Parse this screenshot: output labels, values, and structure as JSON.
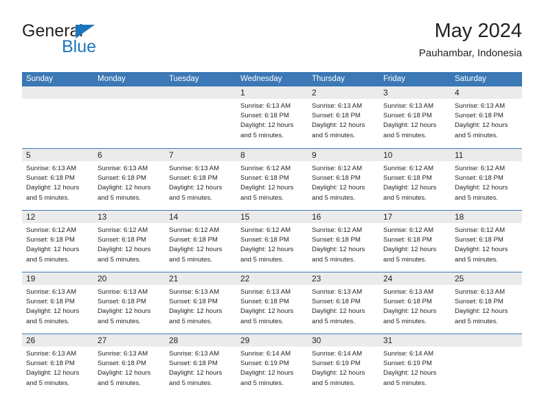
{
  "logo": {
    "word_top": "General",
    "word_bottom": "Blue",
    "triangle_icon": "triangle-icon",
    "color_dark": "#231f20",
    "color_blue": "#1c75bc"
  },
  "header": {
    "title": "May 2024",
    "subtitle": "Pauhambar, Indonesia"
  },
  "theme": {
    "header_blue": "#3b78b5",
    "band_gray": "#ebebeb",
    "text": "#231f20"
  },
  "weekdays": [
    "Sunday",
    "Monday",
    "Tuesday",
    "Wednesday",
    "Thursday",
    "Friday",
    "Saturday"
  ],
  "weeks": [
    [
      {
        "day": "",
        "sunrise": "",
        "sunset": "",
        "daylight_line1": "",
        "daylight_line2": "",
        "empty": true
      },
      {
        "day": "",
        "sunrise": "",
        "sunset": "",
        "daylight_line1": "",
        "daylight_line2": "",
        "empty": true
      },
      {
        "day": "",
        "sunrise": "",
        "sunset": "",
        "daylight_line1": "",
        "daylight_line2": "",
        "empty": true
      },
      {
        "day": "1",
        "sunrise": "Sunrise: 6:13 AM",
        "sunset": "Sunset: 6:18 PM",
        "daylight_line1": "Daylight: 12 hours",
        "daylight_line2": "and 5 minutes.",
        "empty": false
      },
      {
        "day": "2",
        "sunrise": "Sunrise: 6:13 AM",
        "sunset": "Sunset: 6:18 PM",
        "daylight_line1": "Daylight: 12 hours",
        "daylight_line2": "and 5 minutes.",
        "empty": false
      },
      {
        "day": "3",
        "sunrise": "Sunrise: 6:13 AM",
        "sunset": "Sunset: 6:18 PM",
        "daylight_line1": "Daylight: 12 hours",
        "daylight_line2": "and 5 minutes.",
        "empty": false
      },
      {
        "day": "4",
        "sunrise": "Sunrise: 6:13 AM",
        "sunset": "Sunset: 6:18 PM",
        "daylight_line1": "Daylight: 12 hours",
        "daylight_line2": "and 5 minutes.",
        "empty": false
      }
    ],
    [
      {
        "day": "5",
        "sunrise": "Sunrise: 6:13 AM",
        "sunset": "Sunset: 6:18 PM",
        "daylight_line1": "Daylight: 12 hours",
        "daylight_line2": "and 5 minutes.",
        "empty": false
      },
      {
        "day": "6",
        "sunrise": "Sunrise: 6:13 AM",
        "sunset": "Sunset: 6:18 PM",
        "daylight_line1": "Daylight: 12 hours",
        "daylight_line2": "and 5 minutes.",
        "empty": false
      },
      {
        "day": "7",
        "sunrise": "Sunrise: 6:13 AM",
        "sunset": "Sunset: 6:18 PM",
        "daylight_line1": "Daylight: 12 hours",
        "daylight_line2": "and 5 minutes.",
        "empty": false
      },
      {
        "day": "8",
        "sunrise": "Sunrise: 6:12 AM",
        "sunset": "Sunset: 6:18 PM",
        "daylight_line1": "Daylight: 12 hours",
        "daylight_line2": "and 5 minutes.",
        "empty": false
      },
      {
        "day": "9",
        "sunrise": "Sunrise: 6:12 AM",
        "sunset": "Sunset: 6:18 PM",
        "daylight_line1": "Daylight: 12 hours",
        "daylight_line2": "and 5 minutes.",
        "empty": false
      },
      {
        "day": "10",
        "sunrise": "Sunrise: 6:12 AM",
        "sunset": "Sunset: 6:18 PM",
        "daylight_line1": "Daylight: 12 hours",
        "daylight_line2": "and 5 minutes.",
        "empty": false
      },
      {
        "day": "11",
        "sunrise": "Sunrise: 6:12 AM",
        "sunset": "Sunset: 6:18 PM",
        "daylight_line1": "Daylight: 12 hours",
        "daylight_line2": "and 5 minutes.",
        "empty": false
      }
    ],
    [
      {
        "day": "12",
        "sunrise": "Sunrise: 6:12 AM",
        "sunset": "Sunset: 6:18 PM",
        "daylight_line1": "Daylight: 12 hours",
        "daylight_line2": "and 5 minutes.",
        "empty": false
      },
      {
        "day": "13",
        "sunrise": "Sunrise: 6:12 AM",
        "sunset": "Sunset: 6:18 PM",
        "daylight_line1": "Daylight: 12 hours",
        "daylight_line2": "and 5 minutes.",
        "empty": false
      },
      {
        "day": "14",
        "sunrise": "Sunrise: 6:12 AM",
        "sunset": "Sunset: 6:18 PM",
        "daylight_line1": "Daylight: 12 hours",
        "daylight_line2": "and 5 minutes.",
        "empty": false
      },
      {
        "day": "15",
        "sunrise": "Sunrise: 6:12 AM",
        "sunset": "Sunset: 6:18 PM",
        "daylight_line1": "Daylight: 12 hours",
        "daylight_line2": "and 5 minutes.",
        "empty": false
      },
      {
        "day": "16",
        "sunrise": "Sunrise: 6:12 AM",
        "sunset": "Sunset: 6:18 PM",
        "daylight_line1": "Daylight: 12 hours",
        "daylight_line2": "and 5 minutes.",
        "empty": false
      },
      {
        "day": "17",
        "sunrise": "Sunrise: 6:12 AM",
        "sunset": "Sunset: 6:18 PM",
        "daylight_line1": "Daylight: 12 hours",
        "daylight_line2": "and 5 minutes.",
        "empty": false
      },
      {
        "day": "18",
        "sunrise": "Sunrise: 6:12 AM",
        "sunset": "Sunset: 6:18 PM",
        "daylight_line1": "Daylight: 12 hours",
        "daylight_line2": "and 5 minutes.",
        "empty": false
      }
    ],
    [
      {
        "day": "19",
        "sunrise": "Sunrise: 6:13 AM",
        "sunset": "Sunset: 6:18 PM",
        "daylight_line1": "Daylight: 12 hours",
        "daylight_line2": "and 5 minutes.",
        "empty": false
      },
      {
        "day": "20",
        "sunrise": "Sunrise: 6:13 AM",
        "sunset": "Sunset: 6:18 PM",
        "daylight_line1": "Daylight: 12 hours",
        "daylight_line2": "and 5 minutes.",
        "empty": false
      },
      {
        "day": "21",
        "sunrise": "Sunrise: 6:13 AM",
        "sunset": "Sunset: 6:18 PM",
        "daylight_line1": "Daylight: 12 hours",
        "daylight_line2": "and 5 minutes.",
        "empty": false
      },
      {
        "day": "22",
        "sunrise": "Sunrise: 6:13 AM",
        "sunset": "Sunset: 6:18 PM",
        "daylight_line1": "Daylight: 12 hours",
        "daylight_line2": "and 5 minutes.",
        "empty": false
      },
      {
        "day": "23",
        "sunrise": "Sunrise: 6:13 AM",
        "sunset": "Sunset: 6:18 PM",
        "daylight_line1": "Daylight: 12 hours",
        "daylight_line2": "and 5 minutes.",
        "empty": false
      },
      {
        "day": "24",
        "sunrise": "Sunrise: 6:13 AM",
        "sunset": "Sunset: 6:18 PM",
        "daylight_line1": "Daylight: 12 hours",
        "daylight_line2": "and 5 minutes.",
        "empty": false
      },
      {
        "day": "25",
        "sunrise": "Sunrise: 6:13 AM",
        "sunset": "Sunset: 6:18 PM",
        "daylight_line1": "Daylight: 12 hours",
        "daylight_line2": "and 5 minutes.",
        "empty": false
      }
    ],
    [
      {
        "day": "26",
        "sunrise": "Sunrise: 6:13 AM",
        "sunset": "Sunset: 6:18 PM",
        "daylight_line1": "Daylight: 12 hours",
        "daylight_line2": "and 5 minutes.",
        "empty": false
      },
      {
        "day": "27",
        "sunrise": "Sunrise: 6:13 AM",
        "sunset": "Sunset: 6:18 PM",
        "daylight_line1": "Daylight: 12 hours",
        "daylight_line2": "and 5 minutes.",
        "empty": false
      },
      {
        "day": "28",
        "sunrise": "Sunrise: 6:13 AM",
        "sunset": "Sunset: 6:18 PM",
        "daylight_line1": "Daylight: 12 hours",
        "daylight_line2": "and 5 minutes.",
        "empty": false
      },
      {
        "day": "29",
        "sunrise": "Sunrise: 6:14 AM",
        "sunset": "Sunset: 6:19 PM",
        "daylight_line1": "Daylight: 12 hours",
        "daylight_line2": "and 5 minutes.",
        "empty": false
      },
      {
        "day": "30",
        "sunrise": "Sunrise: 6:14 AM",
        "sunset": "Sunset: 6:19 PM",
        "daylight_line1": "Daylight: 12 hours",
        "daylight_line2": "and 5 minutes.",
        "empty": false
      },
      {
        "day": "31",
        "sunrise": "Sunrise: 6:14 AM",
        "sunset": "Sunset: 6:19 PM",
        "daylight_line1": "Daylight: 12 hours",
        "daylight_line2": "and 5 minutes.",
        "empty": false
      },
      {
        "day": "",
        "sunrise": "",
        "sunset": "",
        "daylight_line1": "",
        "daylight_line2": "",
        "empty": true
      }
    ]
  ]
}
